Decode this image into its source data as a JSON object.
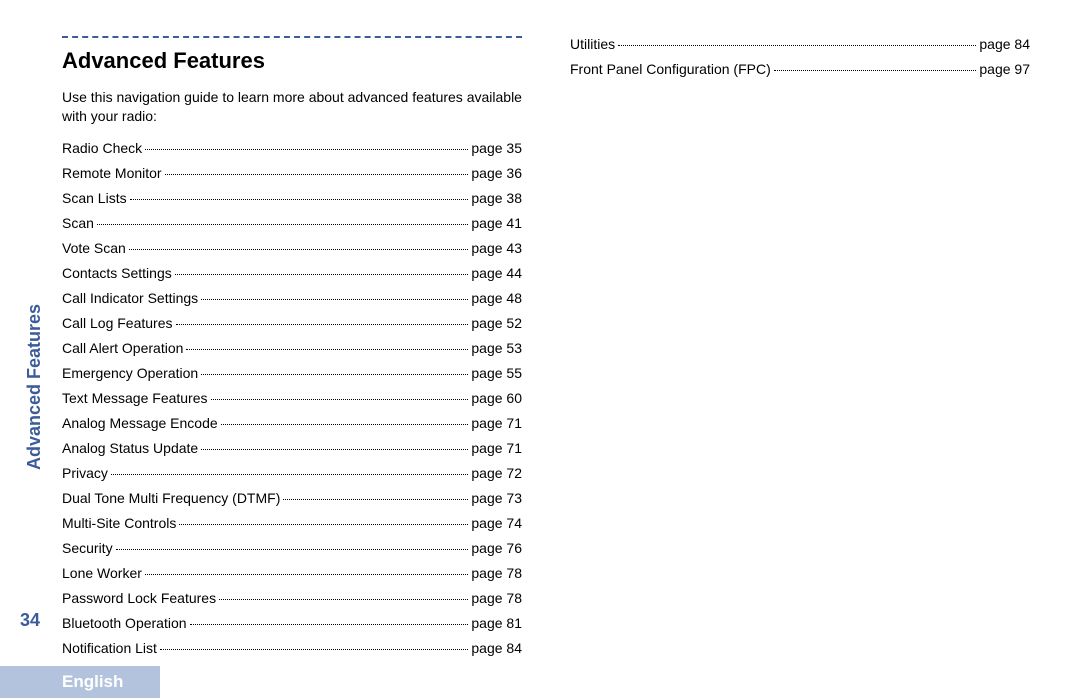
{
  "sidebar": {
    "section_label": "Advanced Features",
    "page_number": "34",
    "language": "English"
  },
  "heading": "Advanced Features",
  "intro": "Use this navigation guide to learn more about advanced features available with your radio:",
  "toc_left": [
    {
      "label": "Radio Check",
      "page": "page 35"
    },
    {
      "label": "Remote Monitor",
      "page": "page 36"
    },
    {
      "label": "Scan Lists",
      "page": "page 38"
    },
    {
      "label": "Scan",
      "page": "page 41"
    },
    {
      "label": "Vote Scan",
      "page": "page 43"
    },
    {
      "label": "Contacts Settings",
      "page": "page 44"
    },
    {
      "label": "Call Indicator Settings",
      "page": "page 48"
    },
    {
      "label": "Call Log Features",
      "page": "page 52"
    },
    {
      "label": "Call Alert Operation",
      "page": "page 53"
    },
    {
      "label": "Emergency Operation",
      "page": "page 55"
    },
    {
      "label": "Text Message Features",
      "page": "page 60"
    },
    {
      "label": "Analog Message Encode",
      "page": "page 71"
    },
    {
      "label": "Analog Status Update",
      "page": "page 71"
    },
    {
      "label": "Privacy",
      "page": "page 72"
    },
    {
      "label": "Dual Tone Multi Frequency (DTMF)",
      "page": "page 73"
    },
    {
      "label": "Multi-Site Controls",
      "page": "page 74"
    },
    {
      "label": "Security",
      "page": "page 76"
    },
    {
      "label": "Lone Worker",
      "page": "page 78"
    },
    {
      "label": "Password Lock Features",
      "page": "page 78"
    },
    {
      "label": "Bluetooth Operation",
      "page": "page 81"
    },
    {
      "label": "Notification List",
      "page": "page 84"
    }
  ],
  "toc_right": [
    {
      "label": "Utilities",
      "page": "page 84"
    },
    {
      "label": "Front Panel Configuration (FPC)",
      "page": "page 97"
    }
  ]
}
